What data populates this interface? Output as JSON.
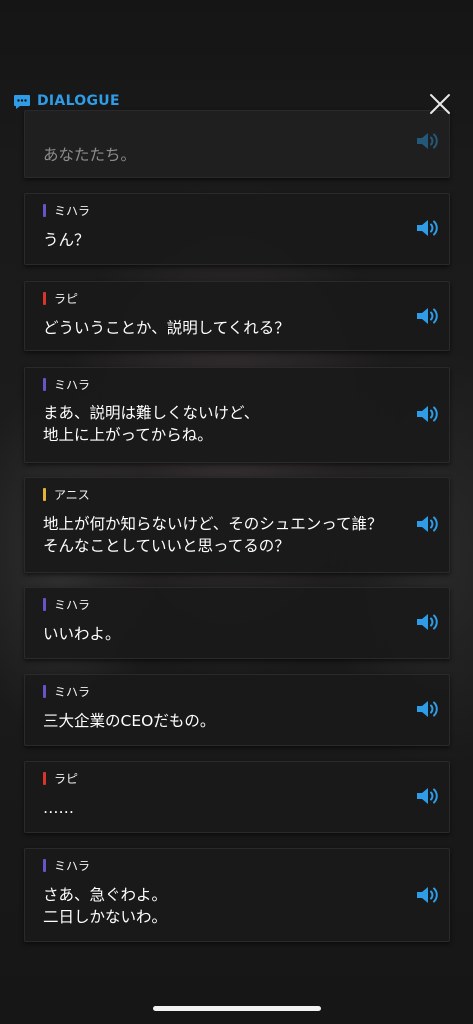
{
  "header": {
    "title": "DIALOGUE"
  },
  "colors": {
    "accent": "#2e9ce6",
    "mihara": "#6a52c9",
    "rapi": "#d9352c",
    "anis": "#e2b33a"
  },
  "icons": {
    "title": "chat-bubble-icon",
    "close": "close-icon",
    "play": "speaker-icon"
  },
  "messages": [
    {
      "speaker": "",
      "lines": [
        "あなたたち。"
      ]
    },
    {
      "speaker": "ミハラ",
      "lines": [
        "うん？"
      ]
    },
    {
      "speaker": "ラピ",
      "lines": [
        "どういうことか、説明してくれる？"
      ]
    },
    {
      "speaker": "ミハラ",
      "lines": [
        "まあ、説明は難しくないけど、",
        "地上に上がってからね。"
      ]
    },
    {
      "speaker": "アニス",
      "lines": [
        "地上が何か知らないけど、そのシュエンって誰？",
        "そんなことしていいと思ってるの？"
      ]
    },
    {
      "speaker": "ミハラ",
      "lines": [
        "いいわよ。"
      ]
    },
    {
      "speaker": "ミハラ",
      "lines": [
        "三大企業のCEOだもの。"
      ]
    },
    {
      "speaker": "ラピ",
      "lines": [
        "……"
      ]
    },
    {
      "speaker": "ミハラ",
      "lines": [
        "さあ、急ぐわよ。",
        "二日しかないわ。"
      ]
    }
  ]
}
